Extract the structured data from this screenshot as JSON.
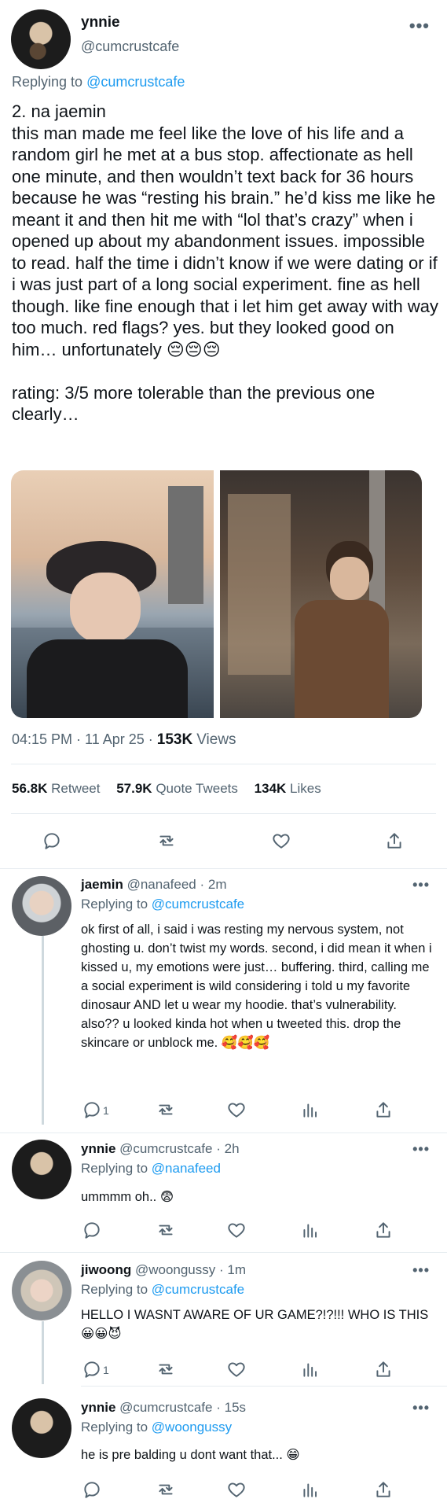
{
  "main_tweet": {
    "display_name": "ynnie",
    "handle": "@cumcrustcafe",
    "replying_prefix": "Replying to",
    "replying_handle": "@cumcrustcafe",
    "body": "2. na jaemin\nthis man made me feel like the love of his life and a random girl he met at a bus stop. affectionate as hell one minute, and then wouldn’t text back for 36 hours because he was “resting his brain.” he’d kiss me like he meant it and then hit me with “lol that’s crazy” when i opened up about my abandonment issues. impossible to read. half the time i didn’t know if we were dating or if i was just part of a long social experiment. fine as hell though. like fine enough that i let him get away with way too much. red flags? yes. but they looked good on him… unfortunately 😔😔😔\n\nrating: 3/5 more tolerable than the previous one clearly…",
    "time": "04:15 PM · 11 Apr 25 ·",
    "views_count": "153K",
    "views_label": "Views",
    "retweets_count": "56.8K",
    "retweets_label": "Retweet",
    "quotes_count": "57.9K",
    "quotes_label": "Quote Tweets",
    "likes_count": "134K",
    "likes_label": "Likes"
  },
  "replies": [
    {
      "display_name": "jaemin",
      "handle": "@nanafeed",
      "time": "· 2m",
      "replying_prefix": "Replying to",
      "replying_handle": "@cumcrustcafe",
      "body": "ok first of all, i said i was resting my nervous system, not ghosting u. don’t twist my words. second, i did mean it when i kissed u, my emotions were just… buffering. third, calling me a social experiment is wild considering i told u my favorite dinosaur AND let u wear my hoodie. that’s vulnerability. also?? u looked kinda hot when u tweeted this. drop the skincare or unblock me. 🥰🥰🥰",
      "reply_count": "1"
    },
    {
      "display_name": "ynnie",
      "handle": "@cumcrustcafe",
      "time": "· 2h",
      "replying_prefix": "Replying to",
      "replying_handle": "@nanafeed",
      "body": "ummmm oh.. 😨",
      "reply_count": ""
    },
    {
      "display_name": "jiwoong",
      "handle": "@woongussy",
      "time": "· 1m",
      "replying_prefix": "Replying to",
      "replying_handle": "@cumcrustcafe",
      "body": "HELLO I WASNT AWARE OF UR GAME?!?!!! WHO IS THIS 😀😀😈",
      "reply_count": "1"
    },
    {
      "display_name": "ynnie",
      "handle": "@cumcrustcafe",
      "time": "· 15s",
      "replying_prefix": "Replying to",
      "replying_handle": "@woongussy",
      "body": "he is pre balding u dont want that... 😁",
      "reply_count": ""
    }
  ],
  "icons": {
    "more": "more-icon",
    "reply": "reply-icon",
    "retweet": "retweet-icon",
    "like": "heart-icon",
    "views": "views-icon",
    "share": "share-icon"
  },
  "colors": {
    "link": "#1d9bf0",
    "muted": "#536471",
    "text": "#0f1419",
    "divider": "#e6ecf0"
  }
}
